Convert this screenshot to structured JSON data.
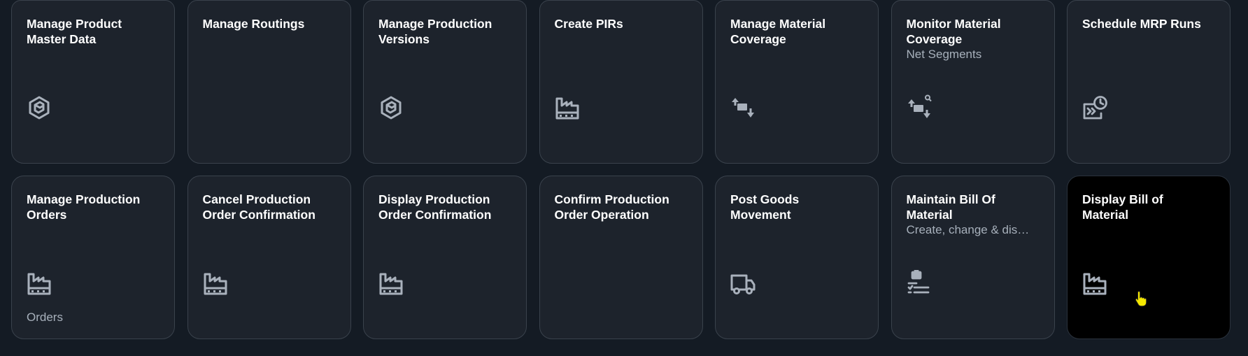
{
  "tiles": [
    {
      "title": "Manage Product\nMaster Data",
      "subtitle": "",
      "footer": "",
      "icon": "product-cube-icon",
      "selected": false
    },
    {
      "title": "Manage Routings",
      "subtitle": "",
      "footer": "",
      "icon": "",
      "selected": false
    },
    {
      "title": "Manage Production\nVersions",
      "subtitle": "",
      "footer": "",
      "icon": "product-cube-icon",
      "selected": false
    },
    {
      "title": "Create PIRs",
      "subtitle": "",
      "footer": "",
      "icon": "factory-icon",
      "selected": false
    },
    {
      "title": "Manage Material\nCoverage",
      "subtitle": "",
      "footer": "",
      "icon": "material-coverage-icon",
      "selected": false
    },
    {
      "title": "Monitor Material\nCoverage",
      "subtitle": "Net Segments",
      "footer": "",
      "icon": "material-coverage-search-icon",
      "selected": false
    },
    {
      "title": "Schedule MRP Runs",
      "subtitle": "",
      "footer": "",
      "icon": "schedule-run-icon",
      "selected": false
    },
    {
      "title": "Manage Production\nOrders",
      "subtitle": "",
      "footer": "Orders",
      "icon": "factory-icon",
      "selected": false
    },
    {
      "title": "Cancel Production\nOrder Confirmation",
      "subtitle": "",
      "footer": "",
      "icon": "factory-icon",
      "selected": false
    },
    {
      "title": "Display Production\nOrder Confirmation",
      "subtitle": "",
      "footer": "",
      "icon": "factory-icon",
      "selected": false
    },
    {
      "title": "Confirm Production\nOrder Operation",
      "subtitle": "",
      "footer": "",
      "icon": "",
      "selected": false
    },
    {
      "title": "Post Goods\nMovement",
      "subtitle": "",
      "footer": "",
      "icon": "shipping-truck-icon",
      "selected": false
    },
    {
      "title": "Maintain Bill Of\nMaterial",
      "subtitle": "Create, change & dis…",
      "footer": "",
      "icon": "bill-of-material-icon",
      "selected": false
    },
    {
      "title": "Display Bill of\nMaterial",
      "subtitle": "",
      "footer": "",
      "icon": "factory-icon",
      "selected": true
    }
  ],
  "colors": {
    "background": "#141b24",
    "tile": "#1d232c",
    "tile_selected": "#000000",
    "icon": "#a9b1bc",
    "cursor": "#f5e800"
  }
}
